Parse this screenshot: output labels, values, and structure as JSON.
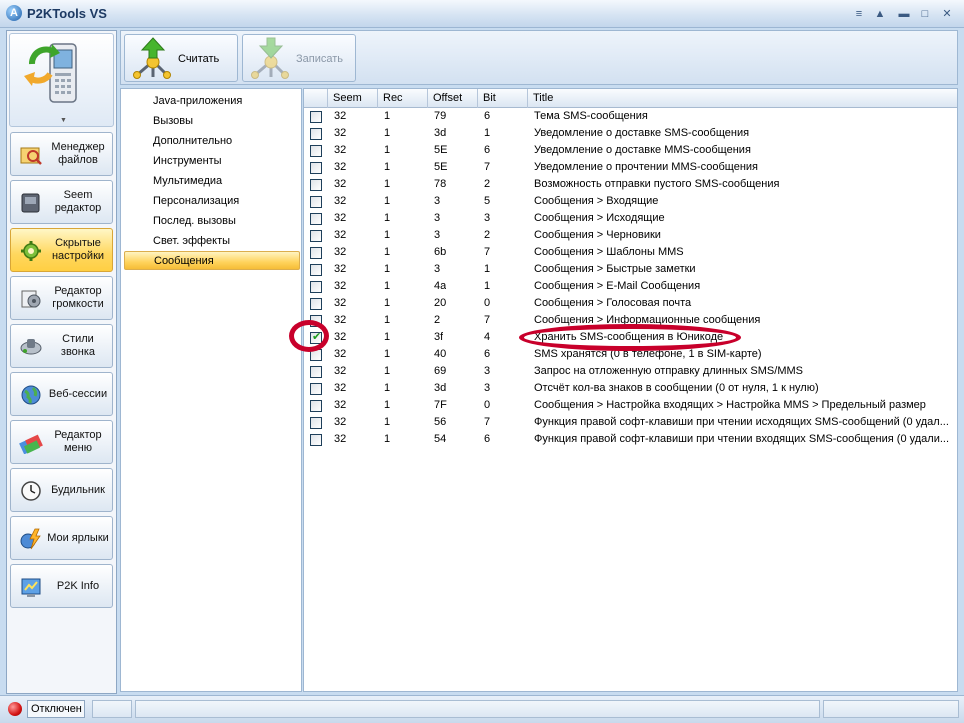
{
  "window": {
    "title": "P2KTools VS"
  },
  "toolbar": {
    "read_label": "Считать",
    "write_label": "Записать"
  },
  "nav": [
    {
      "label": "Менеджер файлов",
      "icon": "file-manager-icon"
    },
    {
      "label": "Seem редактор",
      "icon": "seem-editor-icon"
    },
    {
      "label": "Скрытые настройки",
      "icon": "hidden-settings-icon"
    },
    {
      "label": "Редактор громкости",
      "icon": "volume-editor-icon"
    },
    {
      "label": "Стили звонка",
      "icon": "ring-styles-icon"
    },
    {
      "label": "Веб-сессии",
      "icon": "web-sessions-icon"
    },
    {
      "label": "Редактор меню",
      "icon": "menu-editor-icon"
    },
    {
      "label": "Будильник",
      "icon": "alarm-clock-icon"
    },
    {
      "label": "Мои ярлыки",
      "icon": "shortcuts-icon"
    },
    {
      "label": "P2K Info",
      "icon": "info-icon"
    }
  ],
  "categories": [
    "Java-приложения",
    "Вызовы",
    "Дополнительно",
    "Инструменты",
    "Мультимедиа",
    "Персонализация",
    "Послед. вызовы",
    "Свет. эффекты",
    "Сообщения"
  ],
  "grid": {
    "headers": {
      "seem": "Seem",
      "rec": "Rec",
      "offset": "Offset",
      "bit": "Bit",
      "title": "Title"
    },
    "rows": [
      {
        "seem": "32",
        "rec": "1",
        "offset": "79",
        "bit": "6",
        "title": "Тема SMS-сообщения",
        "checked": false
      },
      {
        "seem": "32",
        "rec": "1",
        "offset": "3d",
        "bit": "1",
        "title": "Уведомление о доставке SMS-сообщения",
        "checked": false
      },
      {
        "seem": "32",
        "rec": "1",
        "offset": "5E",
        "bit": "6",
        "title": "Уведомление о доставке MMS-сообщения",
        "checked": false
      },
      {
        "seem": "32",
        "rec": "1",
        "offset": "5E",
        "bit": "7",
        "title": "Уведомление о прочтении MMS-сообщения",
        "checked": false
      },
      {
        "seem": "32",
        "rec": "1",
        "offset": "78",
        "bit": "2",
        "title": "Возможность отправки пустого SMS-сообщения",
        "checked": false
      },
      {
        "seem": "32",
        "rec": "1",
        "offset": "3",
        "bit": "5",
        "title": "Сообщения > Входящие",
        "checked": false
      },
      {
        "seem": "32",
        "rec": "1",
        "offset": "3",
        "bit": "3",
        "title": "Сообщения > Исходящие",
        "checked": false
      },
      {
        "seem": "32",
        "rec": "1",
        "offset": "3",
        "bit": "2",
        "title": "Сообщения > Черновики",
        "checked": false
      },
      {
        "seem": "32",
        "rec": "1",
        "offset": "6b",
        "bit": "7",
        "title": "Сообщения > Шаблоны MMS",
        "checked": false
      },
      {
        "seem": "32",
        "rec": "1",
        "offset": "3",
        "bit": "1",
        "title": "Сообщения > Быстрые заметки",
        "checked": false
      },
      {
        "seem": "32",
        "rec": "1",
        "offset": "4a",
        "bit": "1",
        "title": "Сообщения > E-Mail Сообщения",
        "checked": false
      },
      {
        "seem": "32",
        "rec": "1",
        "offset": "20",
        "bit": "0",
        "title": "Сообщения > Голосовая почта",
        "checked": false
      },
      {
        "seem": "32",
        "rec": "1",
        "offset": "2",
        "bit": "7",
        "title": "Сообщения > Информационные сообщения",
        "checked": false
      },
      {
        "seem": "32",
        "rec": "1",
        "offset": "3f",
        "bit": "4",
        "title": "Хранить SMS-сообщения в Юникоде",
        "checked": true
      },
      {
        "seem": "32",
        "rec": "1",
        "offset": "40",
        "bit": "6",
        "title": "SMS хранятся (0 в телефоне, 1 в SIM-карте)",
        "checked": false
      },
      {
        "seem": "32",
        "rec": "1",
        "offset": "69",
        "bit": "3",
        "title": "Запрос на отложенную отправку длинных SMS/MMS",
        "checked": false
      },
      {
        "seem": "32",
        "rec": "1",
        "offset": "3d",
        "bit": "3",
        "title": "Отсчёт кол-ва знаков в сообщении (0 от нуля, 1 к нулю)",
        "checked": false
      },
      {
        "seem": "32",
        "rec": "1",
        "offset": "7F",
        "bit": "0",
        "title": "Сообщения > Настройка входящих > Настройка MMS > Предельный размер",
        "checked": false
      },
      {
        "seem": "32",
        "rec": "1",
        "offset": "56",
        "bit": "7",
        "title": "Функция правой софт-клавиши при чтении исходящих SMS-сообщений (0 удал...",
        "checked": false
      },
      {
        "seem": "32",
        "rec": "1",
        "offset": "54",
        "bit": "6",
        "title": "Функция правой софт-клавиши при чтении входящих SMS-сообщения (0 удали...",
        "checked": false
      }
    ]
  },
  "status": {
    "text": "Отключен"
  },
  "colors": {
    "accent": "#ffd35c",
    "highlight": "#c8002b",
    "status_off": "#d41414"
  }
}
